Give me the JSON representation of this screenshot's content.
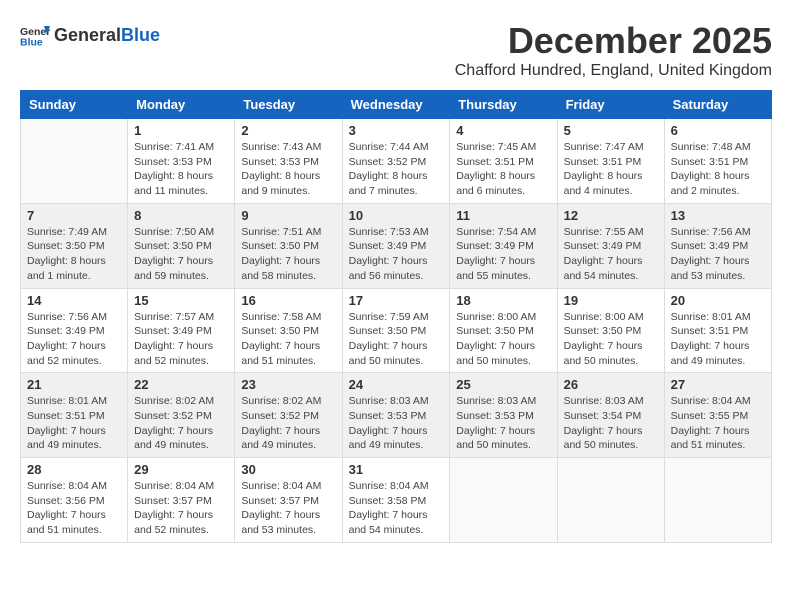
{
  "header": {
    "logo_general": "General",
    "logo_blue": "Blue",
    "month": "December 2025",
    "location": "Chafford Hundred, England, United Kingdom"
  },
  "days_of_week": [
    "Sunday",
    "Monday",
    "Tuesday",
    "Wednesday",
    "Thursday",
    "Friday",
    "Saturday"
  ],
  "weeks": [
    [
      {
        "day": "",
        "info": ""
      },
      {
        "day": "1",
        "info": "Sunrise: 7:41 AM\nSunset: 3:53 PM\nDaylight: 8 hours\nand 11 minutes."
      },
      {
        "day": "2",
        "info": "Sunrise: 7:43 AM\nSunset: 3:53 PM\nDaylight: 8 hours\nand 9 minutes."
      },
      {
        "day": "3",
        "info": "Sunrise: 7:44 AM\nSunset: 3:52 PM\nDaylight: 8 hours\nand 7 minutes."
      },
      {
        "day": "4",
        "info": "Sunrise: 7:45 AM\nSunset: 3:51 PM\nDaylight: 8 hours\nand 6 minutes."
      },
      {
        "day": "5",
        "info": "Sunrise: 7:47 AM\nSunset: 3:51 PM\nDaylight: 8 hours\nand 4 minutes."
      },
      {
        "day": "6",
        "info": "Sunrise: 7:48 AM\nSunset: 3:51 PM\nDaylight: 8 hours\nand 2 minutes."
      }
    ],
    [
      {
        "day": "7",
        "info": "Sunrise: 7:49 AM\nSunset: 3:50 PM\nDaylight: 8 hours\nand 1 minute."
      },
      {
        "day": "8",
        "info": "Sunrise: 7:50 AM\nSunset: 3:50 PM\nDaylight: 7 hours\nand 59 minutes."
      },
      {
        "day": "9",
        "info": "Sunrise: 7:51 AM\nSunset: 3:50 PM\nDaylight: 7 hours\nand 58 minutes."
      },
      {
        "day": "10",
        "info": "Sunrise: 7:53 AM\nSunset: 3:49 PM\nDaylight: 7 hours\nand 56 minutes."
      },
      {
        "day": "11",
        "info": "Sunrise: 7:54 AM\nSunset: 3:49 PM\nDaylight: 7 hours\nand 55 minutes."
      },
      {
        "day": "12",
        "info": "Sunrise: 7:55 AM\nSunset: 3:49 PM\nDaylight: 7 hours\nand 54 minutes."
      },
      {
        "day": "13",
        "info": "Sunrise: 7:56 AM\nSunset: 3:49 PM\nDaylight: 7 hours\nand 53 minutes."
      }
    ],
    [
      {
        "day": "14",
        "info": "Sunrise: 7:56 AM\nSunset: 3:49 PM\nDaylight: 7 hours\nand 52 minutes."
      },
      {
        "day": "15",
        "info": "Sunrise: 7:57 AM\nSunset: 3:49 PM\nDaylight: 7 hours\nand 52 minutes."
      },
      {
        "day": "16",
        "info": "Sunrise: 7:58 AM\nSunset: 3:50 PM\nDaylight: 7 hours\nand 51 minutes."
      },
      {
        "day": "17",
        "info": "Sunrise: 7:59 AM\nSunset: 3:50 PM\nDaylight: 7 hours\nand 50 minutes."
      },
      {
        "day": "18",
        "info": "Sunrise: 8:00 AM\nSunset: 3:50 PM\nDaylight: 7 hours\nand 50 minutes."
      },
      {
        "day": "19",
        "info": "Sunrise: 8:00 AM\nSunset: 3:50 PM\nDaylight: 7 hours\nand 50 minutes."
      },
      {
        "day": "20",
        "info": "Sunrise: 8:01 AM\nSunset: 3:51 PM\nDaylight: 7 hours\nand 49 minutes."
      }
    ],
    [
      {
        "day": "21",
        "info": "Sunrise: 8:01 AM\nSunset: 3:51 PM\nDaylight: 7 hours\nand 49 minutes."
      },
      {
        "day": "22",
        "info": "Sunrise: 8:02 AM\nSunset: 3:52 PM\nDaylight: 7 hours\nand 49 minutes."
      },
      {
        "day": "23",
        "info": "Sunrise: 8:02 AM\nSunset: 3:52 PM\nDaylight: 7 hours\nand 49 minutes."
      },
      {
        "day": "24",
        "info": "Sunrise: 8:03 AM\nSunset: 3:53 PM\nDaylight: 7 hours\nand 49 minutes."
      },
      {
        "day": "25",
        "info": "Sunrise: 8:03 AM\nSunset: 3:53 PM\nDaylight: 7 hours\nand 50 minutes."
      },
      {
        "day": "26",
        "info": "Sunrise: 8:03 AM\nSunset: 3:54 PM\nDaylight: 7 hours\nand 50 minutes."
      },
      {
        "day": "27",
        "info": "Sunrise: 8:04 AM\nSunset: 3:55 PM\nDaylight: 7 hours\nand 51 minutes."
      }
    ],
    [
      {
        "day": "28",
        "info": "Sunrise: 8:04 AM\nSunset: 3:56 PM\nDaylight: 7 hours\nand 51 minutes."
      },
      {
        "day": "29",
        "info": "Sunrise: 8:04 AM\nSunset: 3:57 PM\nDaylight: 7 hours\nand 52 minutes."
      },
      {
        "day": "30",
        "info": "Sunrise: 8:04 AM\nSunset: 3:57 PM\nDaylight: 7 hours\nand 53 minutes."
      },
      {
        "day": "31",
        "info": "Sunrise: 8:04 AM\nSunset: 3:58 PM\nDaylight: 7 hours\nand 54 minutes."
      },
      {
        "day": "",
        "info": ""
      },
      {
        "day": "",
        "info": ""
      },
      {
        "day": "",
        "info": ""
      }
    ]
  ]
}
